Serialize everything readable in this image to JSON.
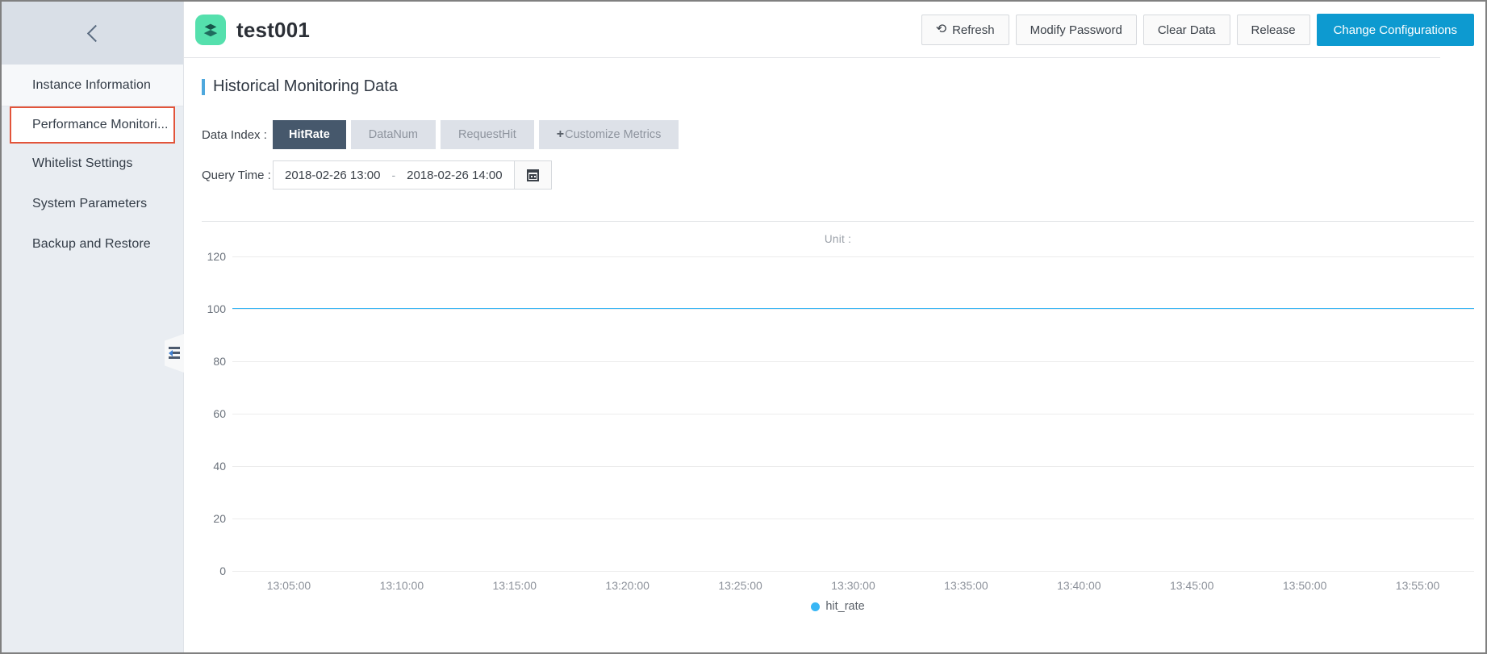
{
  "sidebar": {
    "collapse_icon": "chevron-left-icon",
    "handle_icon": "panel-collapse-icon",
    "items": [
      {
        "label": "Instance Information",
        "active": false
      },
      {
        "label": "Performance Monitori...",
        "active": true
      },
      {
        "label": "Whitelist Settings",
        "active": false
      },
      {
        "label": "System Parameters",
        "active": false
      },
      {
        "label": "Backup and Restore",
        "active": false
      }
    ]
  },
  "topbar": {
    "logo_icon": "layers-cube-icon",
    "logo_color": "#55e0ad",
    "title": "test001",
    "buttons": [
      {
        "label": "Refresh",
        "icon": "refresh-icon",
        "primary": false
      },
      {
        "label": "Modify Password",
        "icon": "",
        "primary": false
      },
      {
        "label": "Clear Data",
        "icon": "",
        "primary": false
      },
      {
        "label": "Release",
        "icon": "",
        "primary": false
      },
      {
        "label": "Change Configurations",
        "icon": "",
        "primary": true
      }
    ],
    "primary_color": "#0d9ad0"
  },
  "section": {
    "title": "Historical Monitoring Data",
    "accent_color": "#4ea8dd"
  },
  "filters": {
    "data_index_label": "Data Index :",
    "metrics": [
      {
        "label": "HitRate",
        "selected": true
      },
      {
        "label": "DataNum",
        "selected": false
      },
      {
        "label": "RequestHit",
        "selected": false
      }
    ],
    "customize_plus": "+",
    "customize_label": "Customize Metrics",
    "query_time_label": "Query Time :",
    "start_time": "2018-02-26 13:00",
    "range_separator": "-",
    "end_time": "2018-02-26 14:00",
    "calendar_icon": "calendar-icon"
  },
  "chart_data": {
    "type": "line",
    "title": "",
    "unit_label": "Unit :",
    "xlabel": "",
    "ylabel": "",
    "ylim": [
      0,
      120
    ],
    "yticks": [
      0,
      20,
      40,
      60,
      80,
      100,
      120
    ],
    "xticks": [
      "13:05:00",
      "13:10:00",
      "13:15:00",
      "13:20:00",
      "13:25:00",
      "13:30:00",
      "13:35:00",
      "13:40:00",
      "13:45:00",
      "13:50:00",
      "13:55:00"
    ],
    "grid": true,
    "legend_position": "bottom",
    "series": [
      {
        "name": "hit_rate",
        "color": "#38b6f5",
        "x": [
          "13:05:00",
          "13:10:00",
          "13:15:00",
          "13:20:00",
          "13:25:00",
          "13:30:00",
          "13:35:00",
          "13:40:00",
          "13:45:00",
          "13:50:00",
          "13:55:00"
        ],
        "values": [
          100,
          100,
          100,
          100,
          100,
          100,
          100,
          100,
          100,
          100,
          100
        ]
      }
    ]
  }
}
